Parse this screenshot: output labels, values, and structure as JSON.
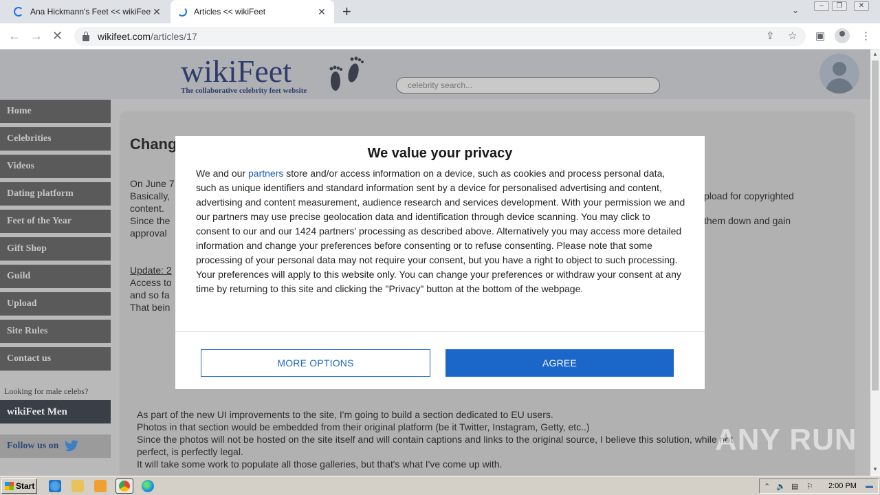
{
  "browser": {
    "tabs": [
      {
        "title": "Ana Hickmann's Feet << wikiFeet",
        "active": false
      },
      {
        "title": "Articles << wikiFeet",
        "active": true
      }
    ],
    "new_tab": "+",
    "url_host": "wikifeet.com",
    "url_path": "/articles/17"
  },
  "site": {
    "logo": "wikiFeet",
    "tagline": "The collaborative celebrity feet website",
    "search_placeholder": "celebrity search...",
    "sidebar": [
      {
        "label": "Home"
      },
      {
        "label": "Celebrities"
      },
      {
        "label": "Videos"
      },
      {
        "label": "Dating platform"
      },
      {
        "label": "Feet of the Year"
      },
      {
        "label": "Gift Shop"
      },
      {
        "label": "Guild"
      },
      {
        "label": "Upload"
      },
      {
        "label": "Site Rules"
      },
      {
        "label": "Contact us"
      }
    ],
    "male_note": "Looking for male celebs?",
    "men_link": "wikiFeet Men",
    "follow_label": "Follow us on"
  },
  "article": {
    "heading": "Chang",
    "p1a": "On June 7",
    "p1b": "Basically,",
    "p1b_right": "pload for copyrighted",
    "p1c": "content.",
    "p1d": "Since the",
    "p1d_right": "them down and gain",
    "p1e": "approval",
    "update": "Update: 2",
    "p2a": "Access to",
    "p2b": "and so fa",
    "p2c": "That bein",
    "p3a": "As part of the new UI improvements to the site, I'm going to build a section dedicated to EU users.",
    "p3b": "Photos in that section would be embedded from their original platform (be it Twitter, Instagram, Getty, etc..)",
    "p3c": "Since the photos will not be hosted on the site itself and will contain captions and links to the original source, I believe this solution, while not",
    "p3d": "perfect, is perfectly legal.",
    "p3e": "It will take some work to populate all those galleries, but that's what I've come up with."
  },
  "consent": {
    "title": "We value your privacy",
    "text_before_link": "We and our ",
    "link": "partners",
    "text_after_link": " store and/or access information on a device, such as cookies and process personal data, such as unique identifiers and standard information sent by a device for personalised advertising and content, advertising and content measurement, audience research and services development. With your permission we and our partners may use precise geolocation data and identification through device scanning. You may click to consent to our and our 1424 partners' processing as described above. Alternatively you may access more detailed information and change your preferences before consenting or to refuse consenting. Please note that some processing of your personal data may not require your consent, but you have a right to object to such processing. Your preferences will apply to this website only. You can change your preferences or withdraw your consent at any time by returning to this site and clicking the \"Privacy\" button at the bottom of the webpage.",
    "more_options": "MORE OPTIONS",
    "agree": "AGREE"
  },
  "watermark": "ANY RUN",
  "taskbar": {
    "start": "Start",
    "clock": "2:00 PM"
  },
  "colors": {
    "accent": "#1b66c9",
    "sidebar_bg": "#5a5a5a",
    "logo": "#2f3c6b"
  }
}
